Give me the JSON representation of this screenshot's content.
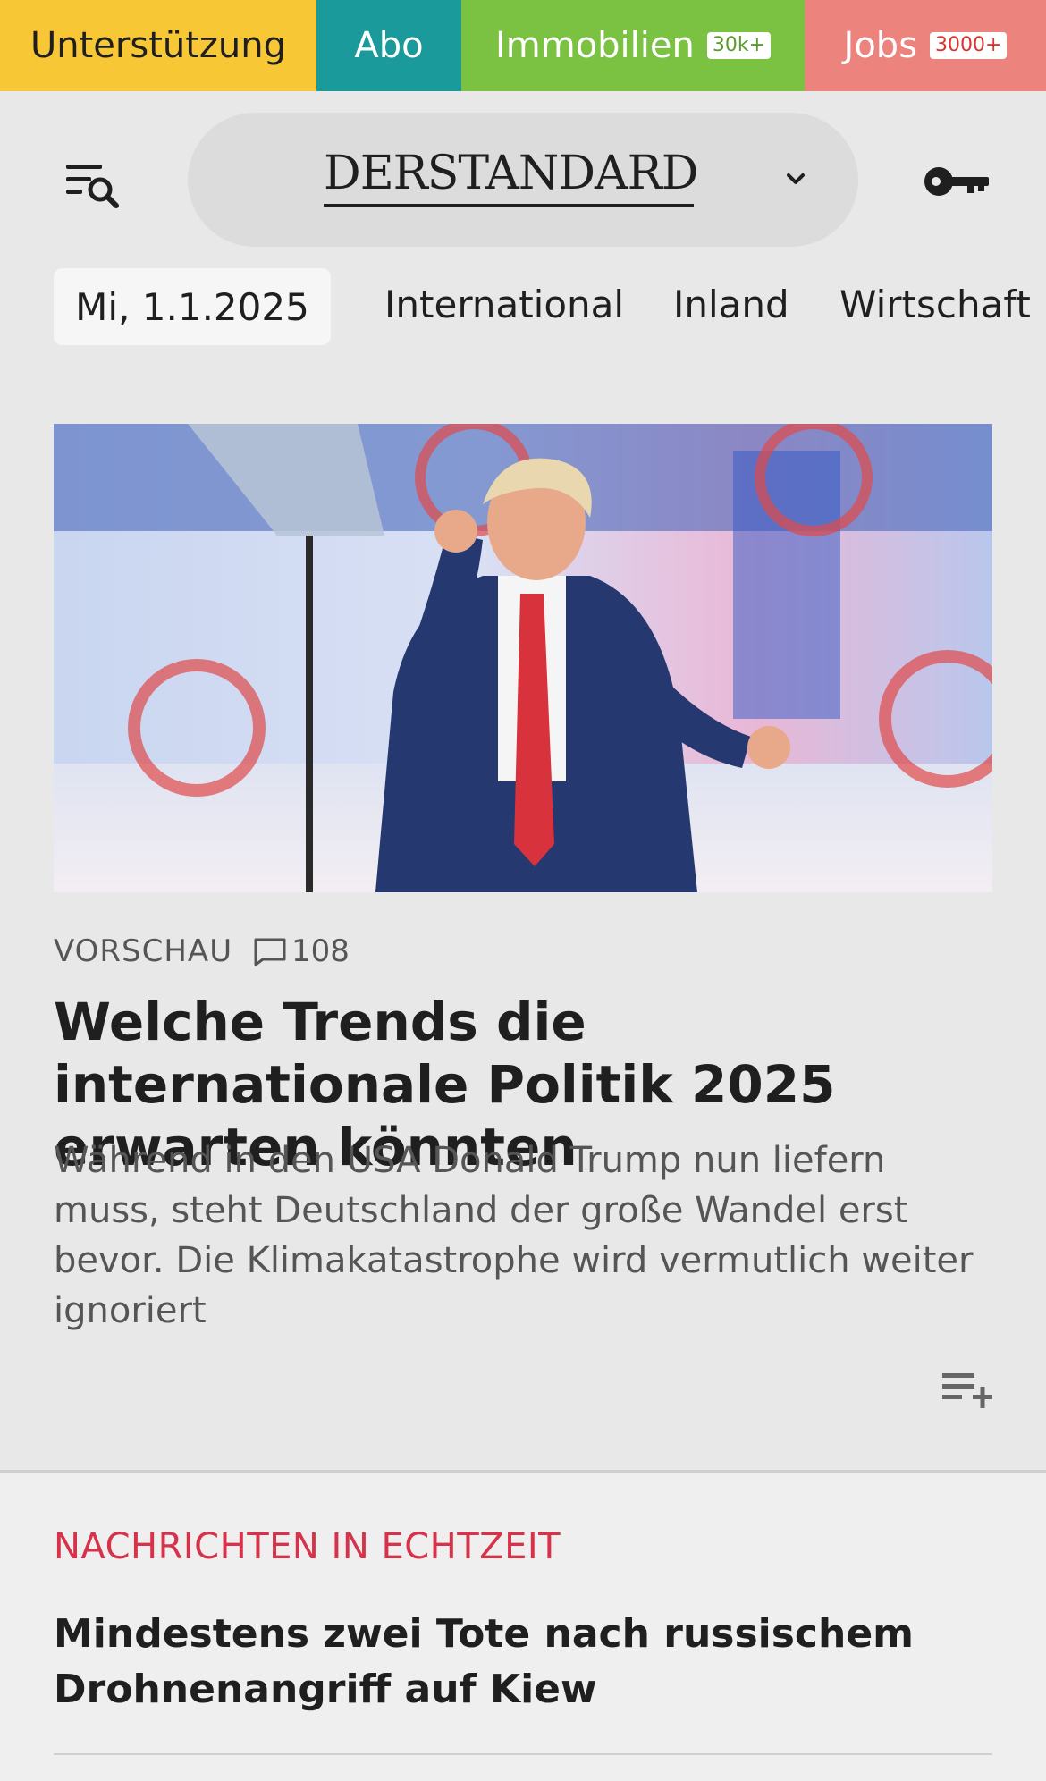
{
  "service_bar": {
    "support": "Unterstützung",
    "abo": "Abo",
    "immobilien": "Immobilien",
    "immobilien_badge": "30k+",
    "jobs": "Jobs",
    "jobs_badge": "3000+"
  },
  "header": {
    "logo": "DERSTANDARD",
    "menu_icon": "menu-search-icon",
    "dropdown_icon": "chevron-down-icon",
    "login_icon": "key-icon"
  },
  "nav": {
    "date": "Mi, 1.1.2025",
    "items": [
      "International",
      "Inland",
      "Wirtschaft"
    ]
  },
  "article": {
    "image_alt": "Donald Trump auf der Bühne bei Turning Point Action",
    "kicker": "VORSCHAU",
    "comment_count": "108",
    "headline": "Welche Trends die internationale Politik 2025 erwarten könnten",
    "teaser": "Während in den USA Donald Trump nun liefern muss, steht Deutschland der große Wandel erst bevor. Die Klimakatastrophe wird vermutlich weiter ignoriert",
    "playlist_icon": "playlist-add-icon"
  },
  "live": {
    "title": "NACHRICHTEN IN ECHTZEIT",
    "headline": "Mindestens zwei Tote nach russischem Drohnen­angriff auf Kiew"
  },
  "colors": {
    "support": "#f7c735",
    "abo": "#1a9a9a",
    "immobilien": "#7cc242",
    "jobs": "#ec837d",
    "live_accent": "#d6334b",
    "background": "#e8e8e8"
  }
}
